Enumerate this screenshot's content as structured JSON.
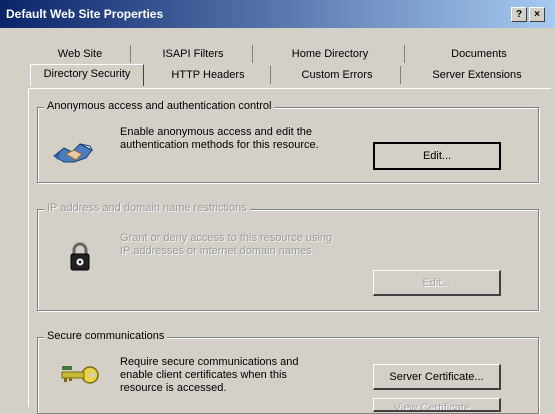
{
  "window": {
    "title": "Default Web Site Properties",
    "help_glyph": "?",
    "close_glyph": "×"
  },
  "tabs": {
    "row1": [
      "Web Site",
      "ISAPI Filters",
      "Home Directory",
      "Documents"
    ],
    "row2": [
      "Directory Security",
      "HTTP Headers",
      "Custom Errors",
      "Server Extensions"
    ]
  },
  "anonymous": {
    "label": "Anonymous access and authentication control",
    "line1": "Enable anonymous access and edit the",
    "line2": "authentication methods for this resource.",
    "button": "Edit..."
  },
  "ip_restrictions": {
    "label": "IP address and domain name restrictions",
    "line1": "Grant or deny access to this resource using",
    "line2": "IP addresses or internet domain names.",
    "button": "Edit..."
  },
  "secure": {
    "label": "Secure communications",
    "line1": "Require secure communications and",
    "line2": "enable client certificates when this",
    "line3": "resource is accessed.",
    "button1": "Server Certificate...",
    "button2": "View Certificate..."
  },
  "icons": {
    "anonymous": "handshake-icon",
    "ip": "padlock-icon",
    "secure": "key-icon"
  }
}
